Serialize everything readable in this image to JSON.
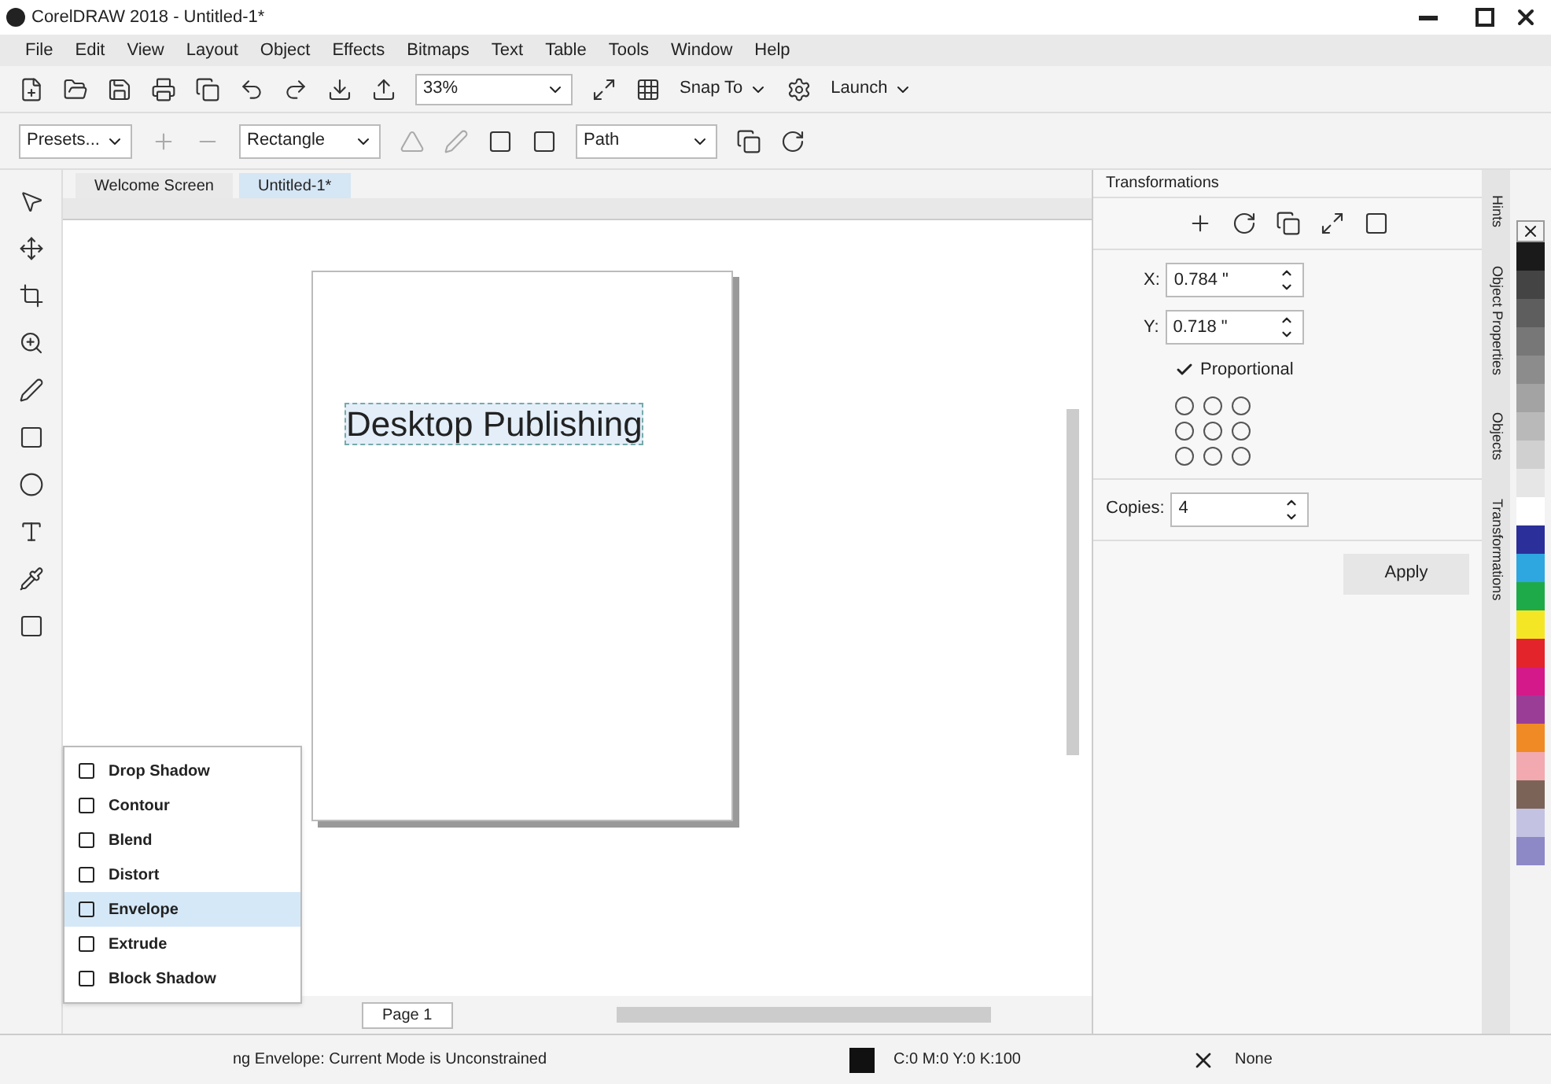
{
  "window": {
    "title": "CorelDRAW 2018 - Untitled-1*"
  },
  "menu": [
    "File",
    "Edit",
    "View",
    "Layout",
    "Object",
    "Effects",
    "Bitmaps",
    "Text",
    "Table",
    "Tools",
    "Window",
    "Help"
  ],
  "toolbar": {
    "zoom": "33%",
    "snap": "Snap To",
    "launch": "Launch"
  },
  "property_bar": {
    "presets": "Presets...",
    "shape": "Rectangle",
    "mode": "Path"
  },
  "tabs": [
    {
      "label": "Welcome Screen",
      "selected": false
    },
    {
      "label": "Untitled-1*",
      "selected": true
    }
  ],
  "canvas": {
    "text": "Desktop Publishing"
  },
  "flyout": [
    {
      "label": "Drop Shadow",
      "selected": false
    },
    {
      "label": "Contour",
      "selected": false
    },
    {
      "label": "Blend",
      "selected": false
    },
    {
      "label": "Distort",
      "selected": false
    },
    {
      "label": "Envelope",
      "selected": true
    },
    {
      "label": "Extrude",
      "selected": false
    },
    {
      "label": "Block Shadow",
      "selected": false
    }
  ],
  "page_tab": "Page 1",
  "transformations": {
    "title": "Transformations",
    "x_label": "X:",
    "x": "0.784 \"",
    "y_label": "Y:",
    "y": "0.718 \"",
    "proportional": {
      "label": "Proportional",
      "checked": true
    },
    "copies_label": "Copies:",
    "copies": "4",
    "apply": "Apply"
  },
  "docker_tabs": [
    "Hints",
    "Object Properties",
    "Objects",
    "Transformations"
  ],
  "palette": [
    {
      "color": "#1a1a1a"
    },
    {
      "color": "#444444"
    },
    {
      "color": "#5e5e5e"
    },
    {
      "color": "#777777"
    },
    {
      "color": "#8c8c8c"
    },
    {
      "color": "#a3a3a3"
    },
    {
      "color": "#b9b9b9"
    },
    {
      "color": "#d0d0d0"
    },
    {
      "color": "#e6e6e6"
    },
    {
      "color": "#ffffff"
    },
    {
      "color": "#2b2f9a"
    },
    {
      "color": "#2ea6e0"
    },
    {
      "color": "#1faa4a"
    },
    {
      "color": "#f5e625"
    },
    {
      "color": "#e3242b"
    },
    {
      "color": "#d4198a"
    },
    {
      "color": "#9a3d97"
    },
    {
      "color": "#f08a24"
    },
    {
      "color": "#f2a9b0"
    },
    {
      "color": "#7b6457"
    },
    {
      "color": "#c4c2e3"
    },
    {
      "color": "#8d88c6"
    }
  ],
  "status_bar": {
    "message": "ng Envelope: Current Mode is Unconstrained",
    "fill": "C:0 M:0 Y:0 K:100",
    "outline": "None"
  }
}
